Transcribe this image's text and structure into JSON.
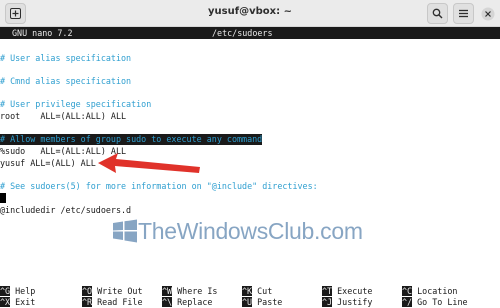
{
  "window": {
    "title": "yusuf@vbox: ~",
    "icons": [
      "new-tab-icon",
      "search-icon",
      "menu-icon",
      "minimize-icon",
      "maximize-icon",
      "close-icon"
    ]
  },
  "nano": {
    "version": "GNU nano 7.2",
    "filename": "/etc/sudoers"
  },
  "file_lines": [
    "# User alias specification",
    "# Cmnd alias specification",
    "# User privilege specification",
    "root    ALL=(ALL:ALL) ALL",
    "# Allow members of group sudo to execute any command",
    "%sudo   ALL=(ALL:ALL) ALL",
    "yusuf ALL=(ALL) ALL",
    "# See sudoers(5) for more information on \"@include\" directives:",
    "@includedir /etc/sudoers.d"
  ],
  "watermark": "TheWindowsClub.com",
  "shortcuts": [
    {
      "key": "^G",
      "label": "Help"
    },
    {
      "key": "^O",
      "label": "Write Out"
    },
    {
      "key": "^W",
      "label": "Where Is"
    },
    {
      "key": "^K",
      "label": "Cut"
    },
    {
      "key": "^T",
      "label": "Execute"
    },
    {
      "key": "^C",
      "label": "Location"
    },
    {
      "key": "^X",
      "label": "Exit"
    },
    {
      "key": "^R",
      "label": "Read File"
    },
    {
      "key": "^\\",
      "label": "Replace"
    },
    {
      "key": "^U",
      "label": "Paste"
    },
    {
      "key": "^J",
      "label": "Justify"
    },
    {
      "key": "^/",
      "label": "Go To Line"
    }
  ],
  "colors": {
    "comment": "#2f9fd0",
    "header_bg": "#1a1a1a",
    "arrow": "#e0322a"
  }
}
